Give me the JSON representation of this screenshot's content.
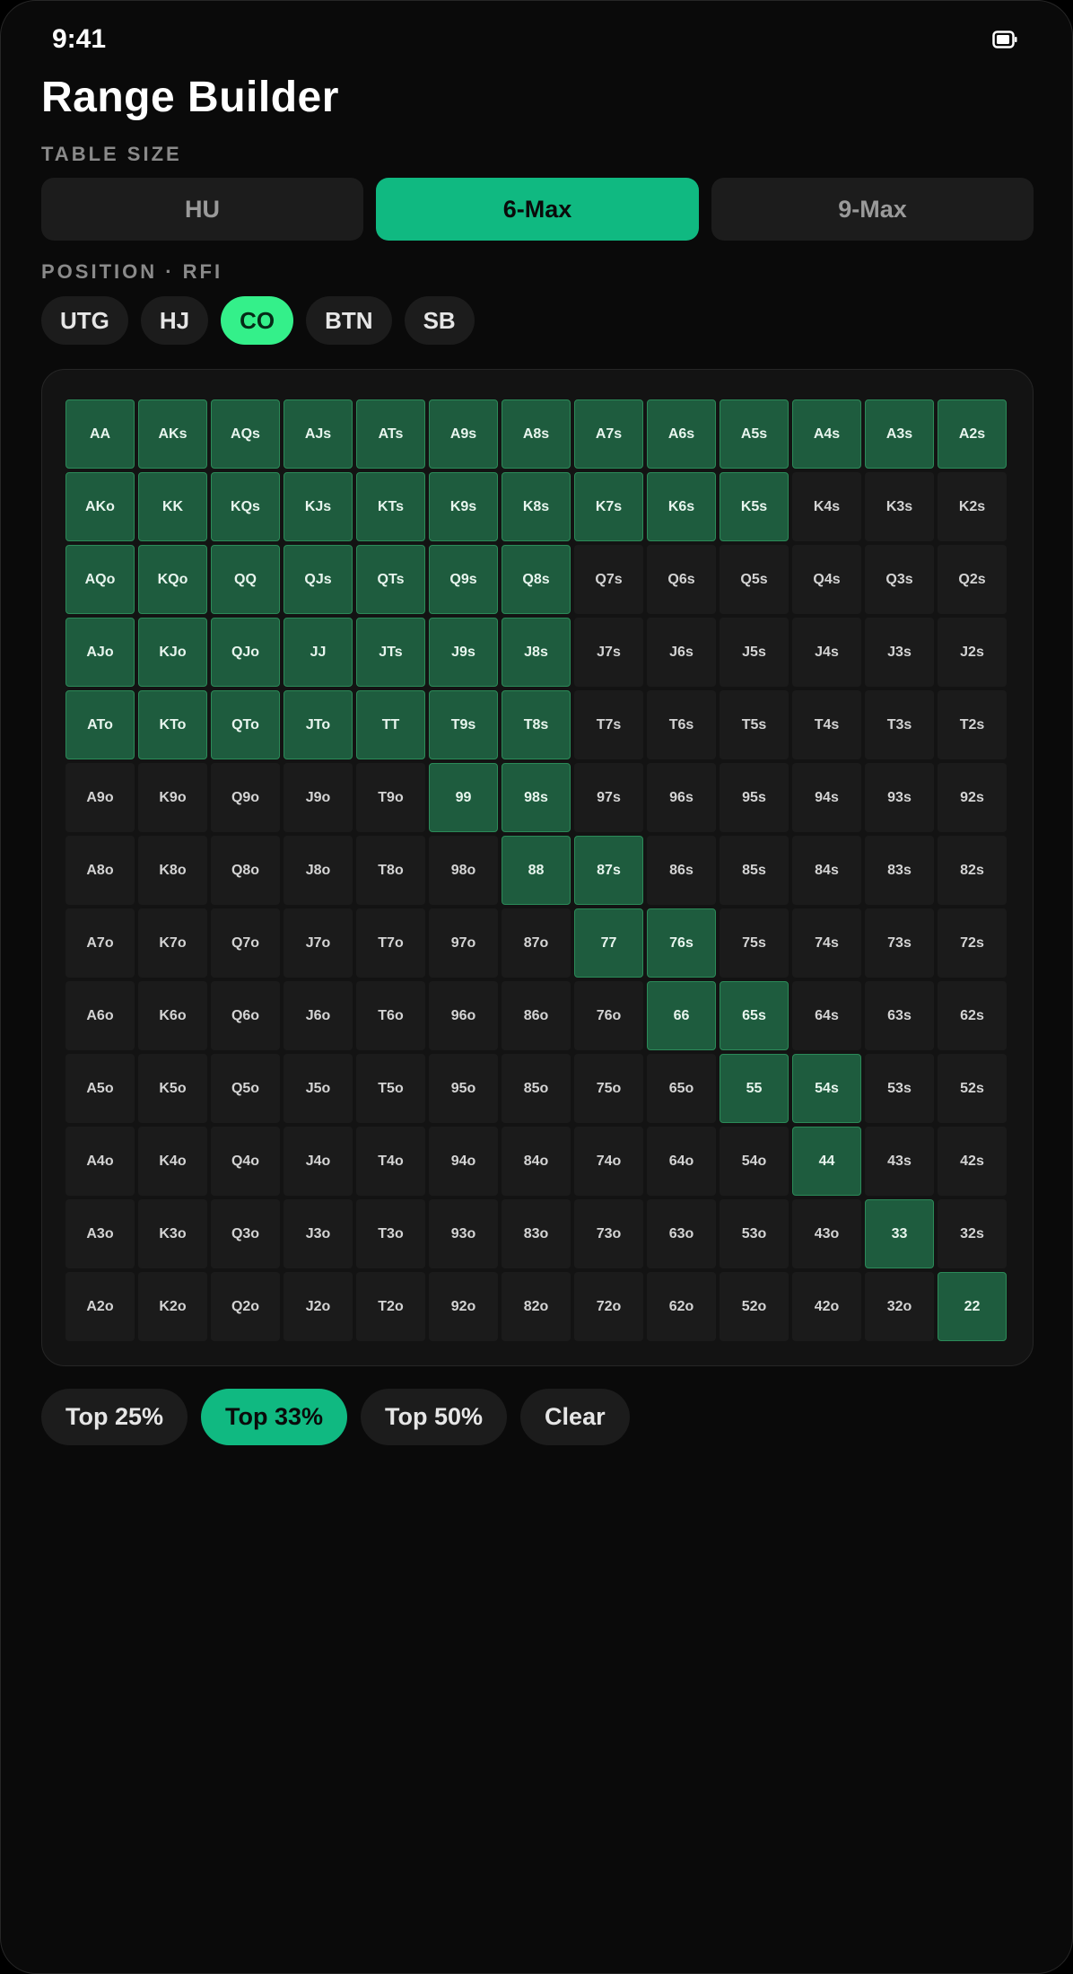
{
  "status": {
    "time": "9:41"
  },
  "page": {
    "title": "Range Builder"
  },
  "table_size": {
    "label": "TABLE SIZE",
    "options": [
      "HU",
      "6-Max",
      "9-Max"
    ],
    "selected": "6-Max"
  },
  "position": {
    "label": "POSITION · RFI",
    "options": [
      "UTG",
      "HJ",
      "CO",
      "BTN",
      "SB"
    ],
    "selected": "CO"
  },
  "grid": {
    "rows": [
      [
        "AA",
        "AKs",
        "AQs",
        "AJs",
        "ATs",
        "A9s",
        "A8s",
        "A7s",
        "A6s",
        "A5s",
        "A4s",
        "A3s",
        "A2s"
      ],
      [
        "AKo",
        "KK",
        "KQs",
        "KJs",
        "KTs",
        "K9s",
        "K8s",
        "K7s",
        "K6s",
        "K5s",
        "K4s",
        "K3s",
        "K2s"
      ],
      [
        "AQo",
        "KQo",
        "QQ",
        "QJs",
        "QTs",
        "Q9s",
        "Q8s",
        "Q7s",
        "Q6s",
        "Q5s",
        "Q4s",
        "Q3s",
        "Q2s"
      ],
      [
        "AJo",
        "KJo",
        "QJo",
        "JJ",
        "JTs",
        "J9s",
        "J8s",
        "J7s",
        "J6s",
        "J5s",
        "J4s",
        "J3s",
        "J2s"
      ],
      [
        "ATo",
        "KTo",
        "QTo",
        "JTo",
        "TT",
        "T9s",
        "T8s",
        "T7s",
        "T6s",
        "T5s",
        "T4s",
        "T3s",
        "T2s"
      ],
      [
        "A9o",
        "K9o",
        "Q9o",
        "J9o",
        "T9o",
        "99",
        "98s",
        "97s",
        "96s",
        "95s",
        "94s",
        "93s",
        "92s"
      ],
      [
        "A8o",
        "K8o",
        "Q8o",
        "J8o",
        "T8o",
        "98o",
        "88",
        "87s",
        "86s",
        "85s",
        "84s",
        "83s",
        "82s"
      ],
      [
        "A7o",
        "K7o",
        "Q7o",
        "J7o",
        "T7o",
        "97o",
        "87o",
        "77",
        "76s",
        "75s",
        "74s",
        "73s",
        "72s"
      ],
      [
        "A6o",
        "K6o",
        "Q6o",
        "J6o",
        "T6o",
        "96o",
        "86o",
        "76o",
        "66",
        "65s",
        "64s",
        "63s",
        "62s"
      ],
      [
        "A5o",
        "K5o",
        "Q5o",
        "J5o",
        "T5o",
        "95o",
        "85o",
        "75o",
        "65o",
        "55",
        "54s",
        "53s",
        "52s"
      ],
      [
        "A4o",
        "K4o",
        "Q4o",
        "J4o",
        "T4o",
        "94o",
        "84o",
        "74o",
        "64o",
        "54o",
        "44",
        "43s",
        "42s"
      ],
      [
        "A3o",
        "K3o",
        "Q3o",
        "J3o",
        "T3o",
        "93o",
        "83o",
        "73o",
        "63o",
        "53o",
        "43o",
        "33",
        "32s"
      ],
      [
        "A2o",
        "K2o",
        "Q2o",
        "J2o",
        "T2o",
        "92o",
        "82o",
        "72o",
        "62o",
        "52o",
        "42o",
        "32o",
        "22"
      ]
    ],
    "selected": [
      "AA",
      "AKs",
      "AQs",
      "AJs",
      "ATs",
      "A9s",
      "A8s",
      "A7s",
      "A6s",
      "A5s",
      "A4s",
      "A3s",
      "A2s",
      "AKo",
      "KK",
      "KQs",
      "KJs",
      "KTs",
      "K9s",
      "K8s",
      "K7s",
      "K6s",
      "K5s",
      "AQo",
      "KQo",
      "QQ",
      "QJs",
      "QTs",
      "Q9s",
      "Q8s",
      "AJo",
      "KJo",
      "QJo",
      "JJ",
      "JTs",
      "J9s",
      "J8s",
      "ATo",
      "KTo",
      "QTo",
      "JTo",
      "TT",
      "T9s",
      "T8s",
      "99",
      "98s",
      "88",
      "87s",
      "77",
      "76s",
      "66",
      "65s",
      "55",
      "54s",
      "44",
      "33",
      "22"
    ]
  },
  "presets": {
    "options": [
      "Top 25%",
      "Top 33%",
      "Top 50%",
      "Clear"
    ],
    "selected": "Top 33%"
  },
  "colors": {
    "accent": "#10b981",
    "position_active": "#34f08a",
    "cell_selected": "#1e5c3e",
    "cell_default": "#1b1b1b",
    "background": "#0a0a0a"
  }
}
